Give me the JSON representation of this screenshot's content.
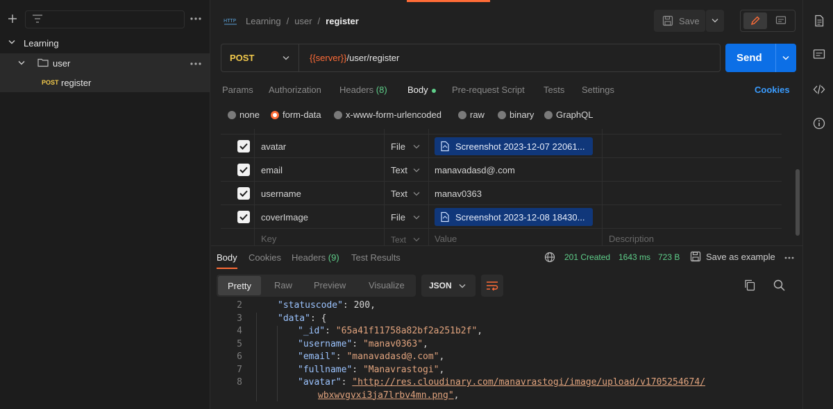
{
  "sidebar": {
    "workspace": "Learning",
    "folder": "user",
    "request_method": "POST",
    "request_name": "register"
  },
  "breadcrumb": {
    "root": "Learning",
    "sep": "/",
    "folder": "user",
    "current": "register"
  },
  "toolbar": {
    "save_label": "Save"
  },
  "request": {
    "method": "POST",
    "url_var": "{{server}}",
    "url_path": "/user/register",
    "send_label": "Send"
  },
  "req_tabs": {
    "params": "Params",
    "authorization": "Authorization",
    "headers": "Headers",
    "headers_count": "(8)",
    "body": "Body",
    "prerequest": "Pre-request Script",
    "tests": "Tests",
    "settings": "Settings",
    "cookies": "Cookies"
  },
  "body_types": {
    "none": "none",
    "form_data": "form-data",
    "urlencoded": "x-www-form-urlencoded",
    "raw": "raw",
    "binary": "binary",
    "graphql": "GraphQL"
  },
  "form_rows": [
    {
      "key": "avatar",
      "type": "File",
      "value": "Screenshot 2023-12-07 22061..."
    },
    {
      "key": "email",
      "type": "Text",
      "value": "manavadasd@.com"
    },
    {
      "key": "username",
      "type": "Text",
      "value": "manav0363"
    },
    {
      "key": "coverImage",
      "type": "File",
      "value": "Screenshot 2023-12-08 18430..."
    }
  ],
  "form_placeholder": {
    "key": "Key",
    "type": "Text",
    "value": "Value",
    "description": "Description"
  },
  "resp_tabs": {
    "body": "Body",
    "cookies": "Cookies",
    "headers": "Headers",
    "headers_count": "(9)",
    "test_results": "Test Results"
  },
  "resp_status": {
    "status": "201 Created",
    "time": "1643 ms",
    "size": "723 B",
    "save_example": "Save as example"
  },
  "resp_view": {
    "pretty": "Pretty",
    "raw": "Raw",
    "preview": "Preview",
    "visualize": "Visualize",
    "format": "JSON"
  },
  "code": {
    "line_numbers": [
      "2",
      "3",
      "4",
      "5",
      "6",
      "7",
      "8"
    ],
    "statuscode_key": "\"statuscode\"",
    "statuscode_val": "200",
    "data_key": "\"data\"",
    "id_key": "\"_id\"",
    "id_val": "\"65a41f11758a82bf2a251b2f\"",
    "username_key": "\"username\"",
    "username_val": "\"manav0363\"",
    "email_key": "\"email\"",
    "email_val": "\"manavadasd@.com\"",
    "fullname_key": "\"fullname\"",
    "fullname_val": "\"Manavrastogi\"",
    "avatar_key": "\"avatar\"",
    "avatar_val_1": "\"http://res.cloudinary.com/manavrastogi/image/upload/v1705254674/",
    "avatar_val_2": "wbxwvgvxi3ja7lrbv4mn.png\""
  },
  "colors": {
    "accent": "#ff6c37",
    "send": "#0c6fe6",
    "status_ok": "#5fcf8a",
    "link_blue": "#3a9cff",
    "file_chip": "#10377a"
  }
}
